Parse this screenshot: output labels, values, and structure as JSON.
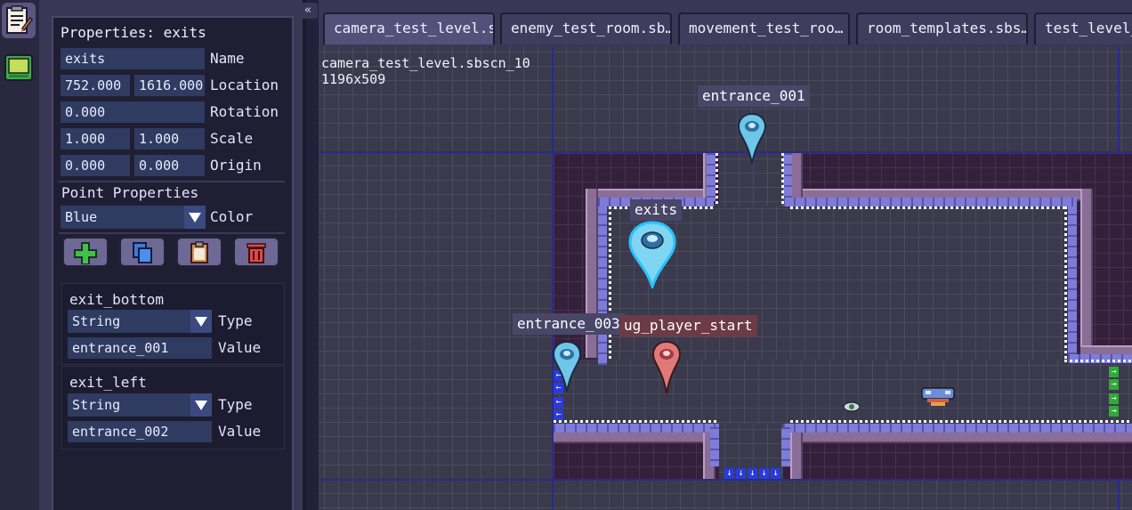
{
  "left_rail": {
    "items": [
      {
        "name": "properties-editor-icon"
      },
      {
        "name": "sprite-sheet-icon"
      }
    ]
  },
  "properties": {
    "title": "Properties: exits",
    "name_value": "exits",
    "name_label": "Name",
    "location_x": "752.000",
    "location_y": "1616.000",
    "location_label": "Location",
    "rotation_value": "0.000",
    "rotation_label": "Rotation",
    "scale_x": "1.000",
    "scale_y": "1.000",
    "scale_label": "Scale",
    "origin_x": "0.000",
    "origin_y": "0.000",
    "origin_label": "Origin",
    "point_properties_title": "Point Properties",
    "color_value": "Blue",
    "color_label": "Color",
    "toolbar": [
      "add-property-icon",
      "copy-icon",
      "paste-icon",
      "delete-icon"
    ],
    "custom_props": [
      {
        "name": "exit_bottom",
        "type_value": "String",
        "type_label": "Type",
        "value": "entrance_001",
        "value_label": "Value"
      },
      {
        "name": "exit_left",
        "type_value": "String",
        "type_label": "Type",
        "value": "entrance_002",
        "value_label": "Value"
      }
    ],
    "collapse_label": "«"
  },
  "tabs": [
    {
      "label": "camera_test_level.s…",
      "active": true
    },
    {
      "label": "enemy_test_room.sb…",
      "active": false
    },
    {
      "label": "movement_test_roo…",
      "active": false
    },
    {
      "label": "room_templates.sbs…",
      "active": false
    },
    {
      "label": "test_level_…",
      "active": false
    }
  ],
  "viewport": {
    "file_name": "camera_test_level.sbscn_10",
    "dimensions": "1196x509",
    "markers": [
      {
        "label": "entrance_001",
        "color": "blue"
      },
      {
        "label": "exits",
        "color": "blue"
      },
      {
        "label": "entrance_003",
        "color": "blue"
      },
      {
        "label": "debug_player_start",
        "visible_label": "ug_player_start",
        "color": "red"
      }
    ]
  },
  "colors": {
    "accent_blue": "#6ec6e8",
    "marker_red": "#e07a78",
    "panel_bg": "#201e33",
    "field_bg": "#2f3b60"
  }
}
